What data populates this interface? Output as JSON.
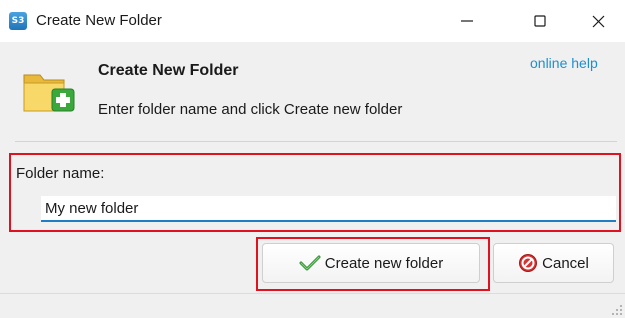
{
  "window": {
    "title": "Create New Folder",
    "app_icon_text": "S3",
    "controls": [
      "minimize-icon",
      "maximize-icon",
      "close-icon"
    ]
  },
  "header": {
    "title": "Create New Folder",
    "subtitle": "Enter folder name and click Create new folder",
    "help_link": "online help",
    "icon": "folder-add-icon"
  },
  "form": {
    "folder_label": "Folder name:",
    "folder_value": "My new folder"
  },
  "buttons": {
    "create_label": "Create new folder",
    "create_icon": "checkmark-icon",
    "cancel_label": "Cancel",
    "cancel_icon": "no-entry-icon"
  },
  "colors": {
    "highlight": "#e0121f",
    "link": "#1f8ecf",
    "input_underline": "#1f7fc5"
  }
}
